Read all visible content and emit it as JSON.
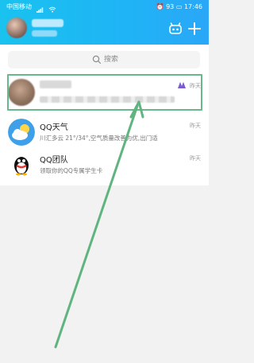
{
  "status_bar": {
    "carrier": "中国移动",
    "battery": "93",
    "time": "17:46"
  },
  "search": {
    "placeholder": "搜索"
  },
  "chats": [
    {
      "title": "",
      "message": "",
      "time": "昨天"
    },
    {
      "title": "QQ天气",
      "message": "川汇多云 21°/34°,空气质量改善为优,出门适",
      "time": "昨天"
    },
    {
      "title": "QQ团队",
      "message": "领取你的QQ专属学生卡",
      "time": "昨天"
    }
  ],
  "colors": {
    "header_gradient_start": "#19c2ef",
    "header_gradient_end": "#2aa7f7",
    "highlight": "#66b98a",
    "arrow": "#5fb47f"
  },
  "icons": {
    "app_icon": "qq-app-icon",
    "add_icon": "plus-icon",
    "search_icon": "search-icon",
    "weather_icon": "weather-cloud-sun-icon",
    "team_icon": "qq-penguin-icon"
  }
}
